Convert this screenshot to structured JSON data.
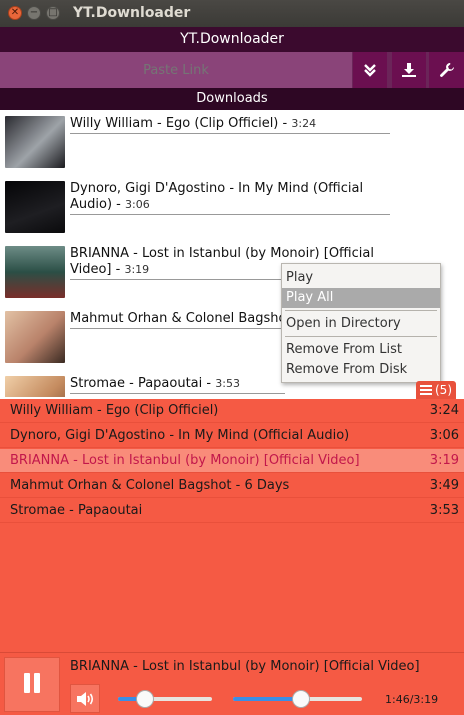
{
  "window": {
    "title": "YT.Downloader",
    "close_glyph": "✕",
    "min_glyph": "−",
    "max_glyph": "□"
  },
  "app": {
    "header": "YT.Downloader",
    "downloads_label": "Downloads"
  },
  "toolbar": {
    "paste_placeholder": "Paste Link",
    "icons": [
      "chevrons-down-icon",
      "download-icon",
      "wrench-icon"
    ]
  },
  "downloads": [
    {
      "title": "Willy William - Ego (Clip Officiel)",
      "duration": "3:24",
      "thumb_colors": [
        "#1b1b1f",
        "#bfc2c6"
      ]
    },
    {
      "title": "Dynoro, Gigi D'Agostino - In My Mind (Official Audio)",
      "duration": "3:06",
      "thumb_colors": [
        "#0c0c0e",
        "#3a3a3e"
      ]
    },
    {
      "title": "BRIANNA - Lost in Istanbul (by Monoir) [Official Video]",
      "duration": "3:19",
      "thumb_colors": [
        "#2c5b52",
        "#b8463f"
      ]
    },
    {
      "title": "Mahmut Orhan & Colonel Bagshot - 6 Days",
      "duration": "3:49",
      "title_visible": "Mahmut Orhan & Colonel Bagsho",
      "thumb_colors": [
        "#d4a98a",
        "#3a2a22"
      ]
    },
    {
      "title": "Stromae - Papaoutai",
      "duration": "3:53",
      "thumb_colors": [
        "#e8b48a",
        "#7a4b30"
      ]
    }
  ],
  "context_menu": {
    "items": [
      "Play",
      "Play All",
      "Open in Directory",
      "Remove From List",
      "Remove From Disk"
    ],
    "active": "Play All"
  },
  "playlist": {
    "count_label": "(5)",
    "rows": [
      {
        "title": "Willy William - Ego (Clip Officiel)",
        "duration": "3:24"
      },
      {
        "title": "Dynoro, Gigi D'Agostino - In My Mind (Official Audio)",
        "duration": "3:06"
      },
      {
        "title": "BRIANNA - Lost in Istanbul (by Monoir) [Official Video]",
        "duration": "3:19"
      },
      {
        "title": "Mahmut Orhan & Colonel Bagshot - 6 Days",
        "duration": "3:49"
      },
      {
        "title": "Stromae - Papaoutai",
        "duration": "3:53"
      }
    ],
    "active_index": 2
  },
  "player": {
    "now_playing": "BRIANNA - Lost in Istanbul (by Monoir) [Official Video]",
    "time": "1:46/3:19",
    "volume_fraction": 0.29,
    "progress_fraction": 0.53
  },
  "colors": {
    "accent": "#6b0f50",
    "playlist_bg": "#f55a44",
    "active_row": "#f98c7a",
    "active_text": "#c2174b",
    "slider_fill": "#3a8ee6"
  }
}
